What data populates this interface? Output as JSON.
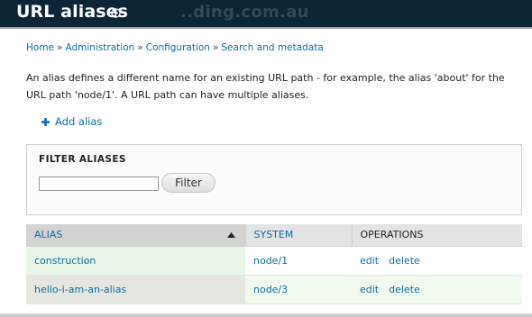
{
  "header": {
    "title": "URL aliases",
    "watermark": "..ding.com.au",
    "shortcut_icon": "plus-circle-icon"
  },
  "breadcrumb": [
    "Home",
    "Administration",
    "Configuration",
    "Search and metadata"
  ],
  "breadcrumb_separator": "»",
  "description": "An alias defines a different name for an existing URL path - for example, the alias 'about' for the URL path 'node/1'. A URL path can have multiple aliases.",
  "add_alias": {
    "label": "Add alias",
    "icon": "plus-icon"
  },
  "filter": {
    "title": "FILTER ALIASES",
    "input_value": "",
    "button_label": "Filter"
  },
  "table": {
    "headers": {
      "alias": "ALIAS",
      "system": "SYSTEM",
      "operations": "OPERATIONS"
    },
    "sort_icon": "sort-ascending-icon",
    "rows": [
      {
        "alias": "construction",
        "system": "node/1",
        "edit": "edit",
        "delete": "delete"
      },
      {
        "alias": "hello-i-am-an-alias",
        "system": "node/3",
        "edit": "edit",
        "delete": "delete"
      }
    ]
  },
  "colors": {
    "header_bg": "#0c2537",
    "link": "#0a6ea6",
    "row_bg": "#f1f9ef"
  }
}
